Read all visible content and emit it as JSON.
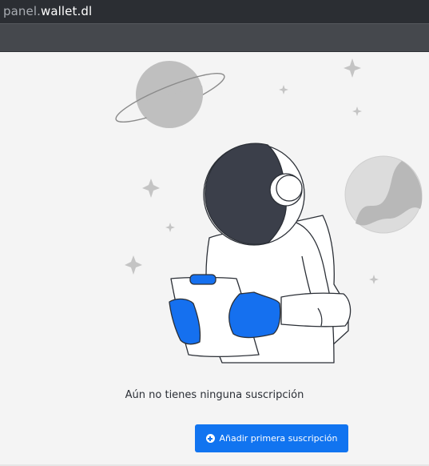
{
  "browser": {
    "url_subdomain": "panel.",
    "url_domain": "wallet.dl"
  },
  "empty_state": {
    "message": "Aún no tienes ninguna suscripción",
    "add_button_label": "Añadir primera suscripción",
    "add_button_icon": "plus-circle-icon"
  },
  "colors": {
    "accent": "#1174f0",
    "illustration_blue": "#1570ef",
    "helmet_visor": "#3b3f4a"
  }
}
